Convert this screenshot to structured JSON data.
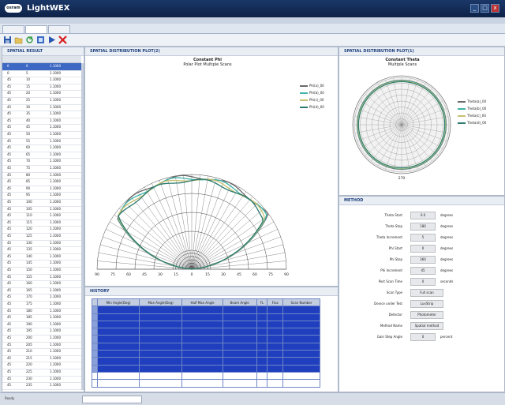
{
  "app": {
    "title": "LightWEX",
    "logo_text": "osram"
  },
  "window_buttons": [
    "_",
    "□",
    "x"
  ],
  "toolbar_icons": [
    "save-icon",
    "open-icon",
    "refresh-icon",
    "export-icon",
    "play-icon",
    "close-icon"
  ],
  "tabs": [
    "",
    "",
    ""
  ],
  "left_panel": {
    "title": "SPATIAL RESULT",
    "columns": [
      "",
      "",
      ""
    ],
    "rows": [
      [
        "0",
        "0",
        "1.1000"
      ],
      [
        "0",
        "5",
        "1.1000"
      ],
      [
        "45",
        "10",
        "1.1000"
      ],
      [
        "45",
        "15",
        "1.1000"
      ],
      [
        "45",
        "20",
        "1.1000"
      ],
      [
        "45",
        "25",
        "1.1000"
      ],
      [
        "45",
        "30",
        "1.1000"
      ],
      [
        "45",
        "35",
        "1.1000"
      ],
      [
        "45",
        "40",
        "1.1000"
      ],
      [
        "45",
        "45",
        "1.1000"
      ],
      [
        "45",
        "50",
        "1.1000"
      ],
      [
        "45",
        "55",
        "1.1000"
      ],
      [
        "45",
        "60",
        "1.1000"
      ],
      [
        "45",
        "65",
        "1.1000"
      ],
      [
        "45",
        "70",
        "1.1000"
      ],
      [
        "45",
        "75",
        "1.1000"
      ],
      [
        "45",
        "80",
        "1.1000"
      ],
      [
        "45",
        "85",
        "1.1000"
      ],
      [
        "45",
        "90",
        "1.1000"
      ],
      [
        "45",
        "95",
        "1.1000"
      ],
      [
        "45",
        "100",
        "1.1000"
      ],
      [
        "45",
        "105",
        "1.1000"
      ],
      [
        "45",
        "110",
        "1.1000"
      ],
      [
        "45",
        "115",
        "1.1000"
      ],
      [
        "45",
        "120",
        "1.1000"
      ],
      [
        "45",
        "125",
        "1.1000"
      ],
      [
        "45",
        "130",
        "1.1000"
      ],
      [
        "45",
        "135",
        "1.1000"
      ],
      [
        "45",
        "140",
        "1.1000"
      ],
      [
        "45",
        "145",
        "1.1000"
      ],
      [
        "45",
        "150",
        "1.1000"
      ],
      [
        "45",
        "155",
        "1.1000"
      ],
      [
        "45",
        "160",
        "1.1000"
      ],
      [
        "45",
        "165",
        "1.1000"
      ],
      [
        "45",
        "170",
        "1.1000"
      ],
      [
        "45",
        "175",
        "1.1000"
      ],
      [
        "45",
        "180",
        "1.1000"
      ],
      [
        "45",
        "185",
        "1.1000"
      ],
      [
        "45",
        "190",
        "1.1000"
      ],
      [
        "45",
        "195",
        "1.1000"
      ],
      [
        "45",
        "200",
        "1.1000"
      ],
      [
        "45",
        "205",
        "1.1000"
      ],
      [
        "45",
        "210",
        "1.1000"
      ],
      [
        "45",
        "215",
        "1.1000"
      ],
      [
        "45",
        "220",
        "1.1000"
      ],
      [
        "45",
        "225",
        "1.1000"
      ],
      [
        "45",
        "230",
        "1.1000"
      ],
      [
        "45",
        "235",
        "1.1000"
      ],
      [
        "45",
        "240",
        "1.1000"
      ]
    ]
  },
  "center_panel": {
    "title": "SPATIAL DISTRIBUTION PLOT(2)",
    "chart_title": "Constant Phi",
    "chart_subtitle": "Polar Plot Multiple Scans",
    "legend": [
      "Phi(a)_00",
      "Phi(b)_00",
      "Phi(c)_00",
      "Phi(d)_00"
    ],
    "series_colors": [
      "#6a6a6a",
      "#3fb3a7",
      "#c8c070",
      "#2a7a6e"
    ],
    "x_ticks": [
      "90",
      "75",
      "60",
      "45",
      "30",
      "15",
      "0",
      "15",
      "30",
      "45",
      "60",
      "75",
      "90"
    ]
  },
  "right_panel": {
    "title": "SPATIAL DISTRIBUTION PLOT(1)",
    "chart_title": "Constant Theta",
    "chart_subtitle": "Multiple Scans",
    "legend": [
      "Theta(a)_00",
      "Theta(b)_00",
      "Theta(c)_00",
      "Theta(d)_00"
    ],
    "bottom_tick": "270"
  },
  "method_panel": {
    "title": "METHOD",
    "rows": [
      {
        "label": "Theta Start",
        "value": "0.0",
        "unit": "degrees"
      },
      {
        "label": "Theta Stop",
        "value": "180",
        "unit": "degrees"
      },
      {
        "label": "Theta Increment",
        "value": "5",
        "unit": "degrees"
      },
      {
        "label": "Phi Start",
        "value": "0",
        "unit": "degrees"
      },
      {
        "label": "Phi Stop",
        "value": "360",
        "unit": "degrees"
      },
      {
        "label": "Phi Increment",
        "value": "45",
        "unit": "degrees"
      },
      {
        "label": "Post Scan Time",
        "value": "0",
        "unit": "seconds"
      },
      {
        "label": "Scan Type",
        "value": "Full scan",
        "unit": ""
      },
      {
        "label": "Device under Test",
        "value": "LuxStrip",
        "unit": ""
      },
      {
        "label": "Detector",
        "value": "Photometer",
        "unit": ""
      },
      {
        "label": "Method Name",
        "value": "Spatial method",
        "unit": ""
      },
      {
        "label": "Gain Step Angle",
        "value": "0",
        "unit": "percent"
      }
    ]
  },
  "bottom_panel": {
    "title": "HISTORY",
    "columns": [
      "",
      "Min Angle(Deg)",
      "Max Angle(Deg)",
      "Half Max Angle",
      "Beam Angle",
      "FL",
      "Flux",
      "Scan Number"
    ],
    "rows": [
      [
        "",
        "",
        "",
        "",
        "",
        "",
        "",
        ""
      ],
      [
        "",
        "",
        "",
        "",
        "",
        "",
        "",
        ""
      ],
      [
        "",
        "",
        "",
        "",
        "",
        "",
        "",
        ""
      ],
      [
        "",
        "",
        "",
        "",
        "",
        "",
        "",
        ""
      ],
      [
        "",
        "",
        "",
        "",
        "",
        "",
        "",
        ""
      ],
      [
        "",
        "",
        "",
        "",
        "",
        "",
        "",
        ""
      ],
      [
        "",
        "",
        "",
        "",
        "",
        "",
        "",
        ""
      ],
      [
        "",
        "",
        "",
        "",
        "",
        "",
        "",
        ""
      ],
      [
        "",
        "",
        "",
        "",
        "",
        "",
        "",
        ""
      ],
      [
        "",
        "",
        "",
        "",
        "",
        "",
        "",
        ""
      ],
      [
        "",
        "",
        "",
        "",
        "",
        "",
        "",
        ""
      ]
    ]
  },
  "status_bar": [
    "Ready",
    "",
    "",
    "",
    ""
  ]
}
